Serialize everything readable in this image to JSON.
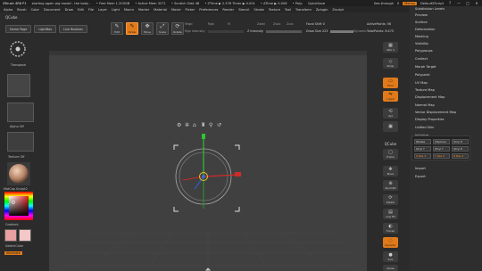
{
  "titlebar": {
    "app": "ZBrush 4R8 P1",
    "doc": "starting again pig model - the body -",
    "free_mem": "• Free Mem 1.203GB",
    "active_mem": "• Active Mem 3271",
    "scratch": "• Scratch Disk 48",
    "ztime": "• ZTime ▶ 2.378 Timer ▶ 0.001",
    "atime": "• ATime ▶ 0.006",
    "poly": "• Poly:",
    "quicksave": "QuickSave",
    "seethrough": "See-through",
    "seethrough_val": "0",
    "menus": "Menus",
    "script": "DefaultZScript",
    "win_btns": [
      "?",
      "—",
      "▢",
      "✕"
    ]
  },
  "menubar": [
    "Alpha",
    "Brush",
    "Color",
    "Document",
    "Draw",
    "Edit",
    "File",
    "Layer",
    "Light",
    "Macro",
    "Marker",
    "Material",
    "Movie",
    "Picker",
    "Preferences",
    "Render",
    "Stencil",
    "Stroke",
    "Texture",
    "Tool",
    "Transform",
    "Zplugin",
    "Zscript"
  ],
  "top_left": {
    "qcube": "QCube",
    "buttons": [
      "Home Page",
      "LightBox",
      "Live Boolean"
    ]
  },
  "top_icons": [
    {
      "label": "Edit",
      "glyph": "✎",
      "icon": "edit-icon",
      "active": false
    },
    {
      "label": "Draw",
      "glyph": "✎",
      "icon": "draw-icon",
      "active": true
    },
    {
      "label": "Move",
      "glyph": "✥",
      "icon": "move-icon",
      "active": false
    },
    {
      "label": "Scale",
      "glyph": "⤢",
      "icon": "scale-icon",
      "active": false
    },
    {
      "label": "Rotate",
      "glyph": "⟳",
      "icon": "rotate-icon",
      "active": false
    }
  ],
  "sliders": {
    "mrgb": "Mrgb",
    "rgb": "Rgb",
    "m": "M",
    "zadd": "Zadd",
    "zsub": "Zsub",
    "zcut": "Zcut",
    "rgb_intensity": "Rgb Intensity",
    "z_intensity": "Z Intensity",
    "focal_shift": "Focal Shift 0",
    "draw_size": "Draw Size 223",
    "dynamic": "Dynamic",
    "active_points": "ActivePoints: 56",
    "total_points": "TotalPoints: 8.475"
  },
  "left": {
    "transpose": "Transpose",
    "alpha_off": "Alpha Off",
    "texture_off": "Texture Off",
    "matcap": "MatCap Sculpt2",
    "gradient": "Gradient",
    "switch_color": "SwitchColor",
    "alternate": "Alternate"
  },
  "right_strip": [
    {
      "label": "SPix 3",
      "glyph": "▦",
      "icon": "spix-icon",
      "style": "normal"
    },
    {
      "label": "Persp",
      "glyph": "◇",
      "icon": "persp-icon",
      "style": "normal"
    },
    {
      "label": "Floor",
      "glyph": "▭",
      "icon": "floor-icon",
      "style": "orange"
    },
    {
      "label": "L.Sym",
      "glyph": "⇋",
      "icon": "local-symmetry-icon",
      "style": "orange"
    },
    {
      "label": "Xyz",
      "glyph": "⟲",
      "icon": "xyz-rotate-icon",
      "style": "normal"
    },
    {
      "label": "QCube",
      "glyph": "",
      "icon": "qcube-icon",
      "style": "normal"
    },
    {
      "label": "Frame",
      "glyph": "▢",
      "icon": "frame-icon",
      "style": "normal"
    },
    {
      "label": "Move",
      "glyph": "✥",
      "icon": "move-view-icon",
      "style": "round"
    },
    {
      "label": "Zoom3D",
      "glyph": "⊕",
      "icon": "zoom3d-icon",
      "style": "round"
    },
    {
      "label": "Rotate",
      "glyph": "⟳",
      "icon": "rotate-view-icon",
      "style": "round"
    },
    {
      "label": "Line Fill",
      "glyph": "▤",
      "icon": "line-fill-icon",
      "style": "normal"
    },
    {
      "label": "Transp",
      "glyph": "◐",
      "icon": "transp-icon",
      "style": "normal"
    },
    {
      "label": "Dynamic",
      "glyph": "◌",
      "icon": "dynamic-icon",
      "style": "normal"
    },
    {
      "label": "Solo",
      "glyph": "●",
      "icon": "solo-icon",
      "style": "normal"
    },
    {
      "label": "Xpose",
      "glyph": "✦",
      "icon": "xpose-icon",
      "style": "normal"
    }
  ],
  "right_menu": {
    "items": [
      "Subdivision Levels",
      "Preview",
      "Surface",
      "Deformation",
      "Masking",
      "Visibility",
      "Polygroups",
      "Contact",
      "Morph Target",
      "Polypaint",
      "UV Map",
      "Texture Map",
      "Displacement Map",
      "Normal Map",
      "Vector Displacement Map",
      "Display Properties",
      "Unified Skin",
      "Initialize"
    ],
    "initialize_buttons": [
      "QCube",
      "QSphere",
      "QCyl Z",
      "QCyl Y",
      "QCyl Y",
      "QCyl Z"
    ],
    "initialize_values": [
      "X Res 2",
      "Y Res 5",
      "Z Res 2"
    ],
    "after": [
      "Import",
      "Export"
    ]
  },
  "colors": {
    "accent": "#e07a1a",
    "bg": "#2b2b2b",
    "canvas": "#404040"
  }
}
